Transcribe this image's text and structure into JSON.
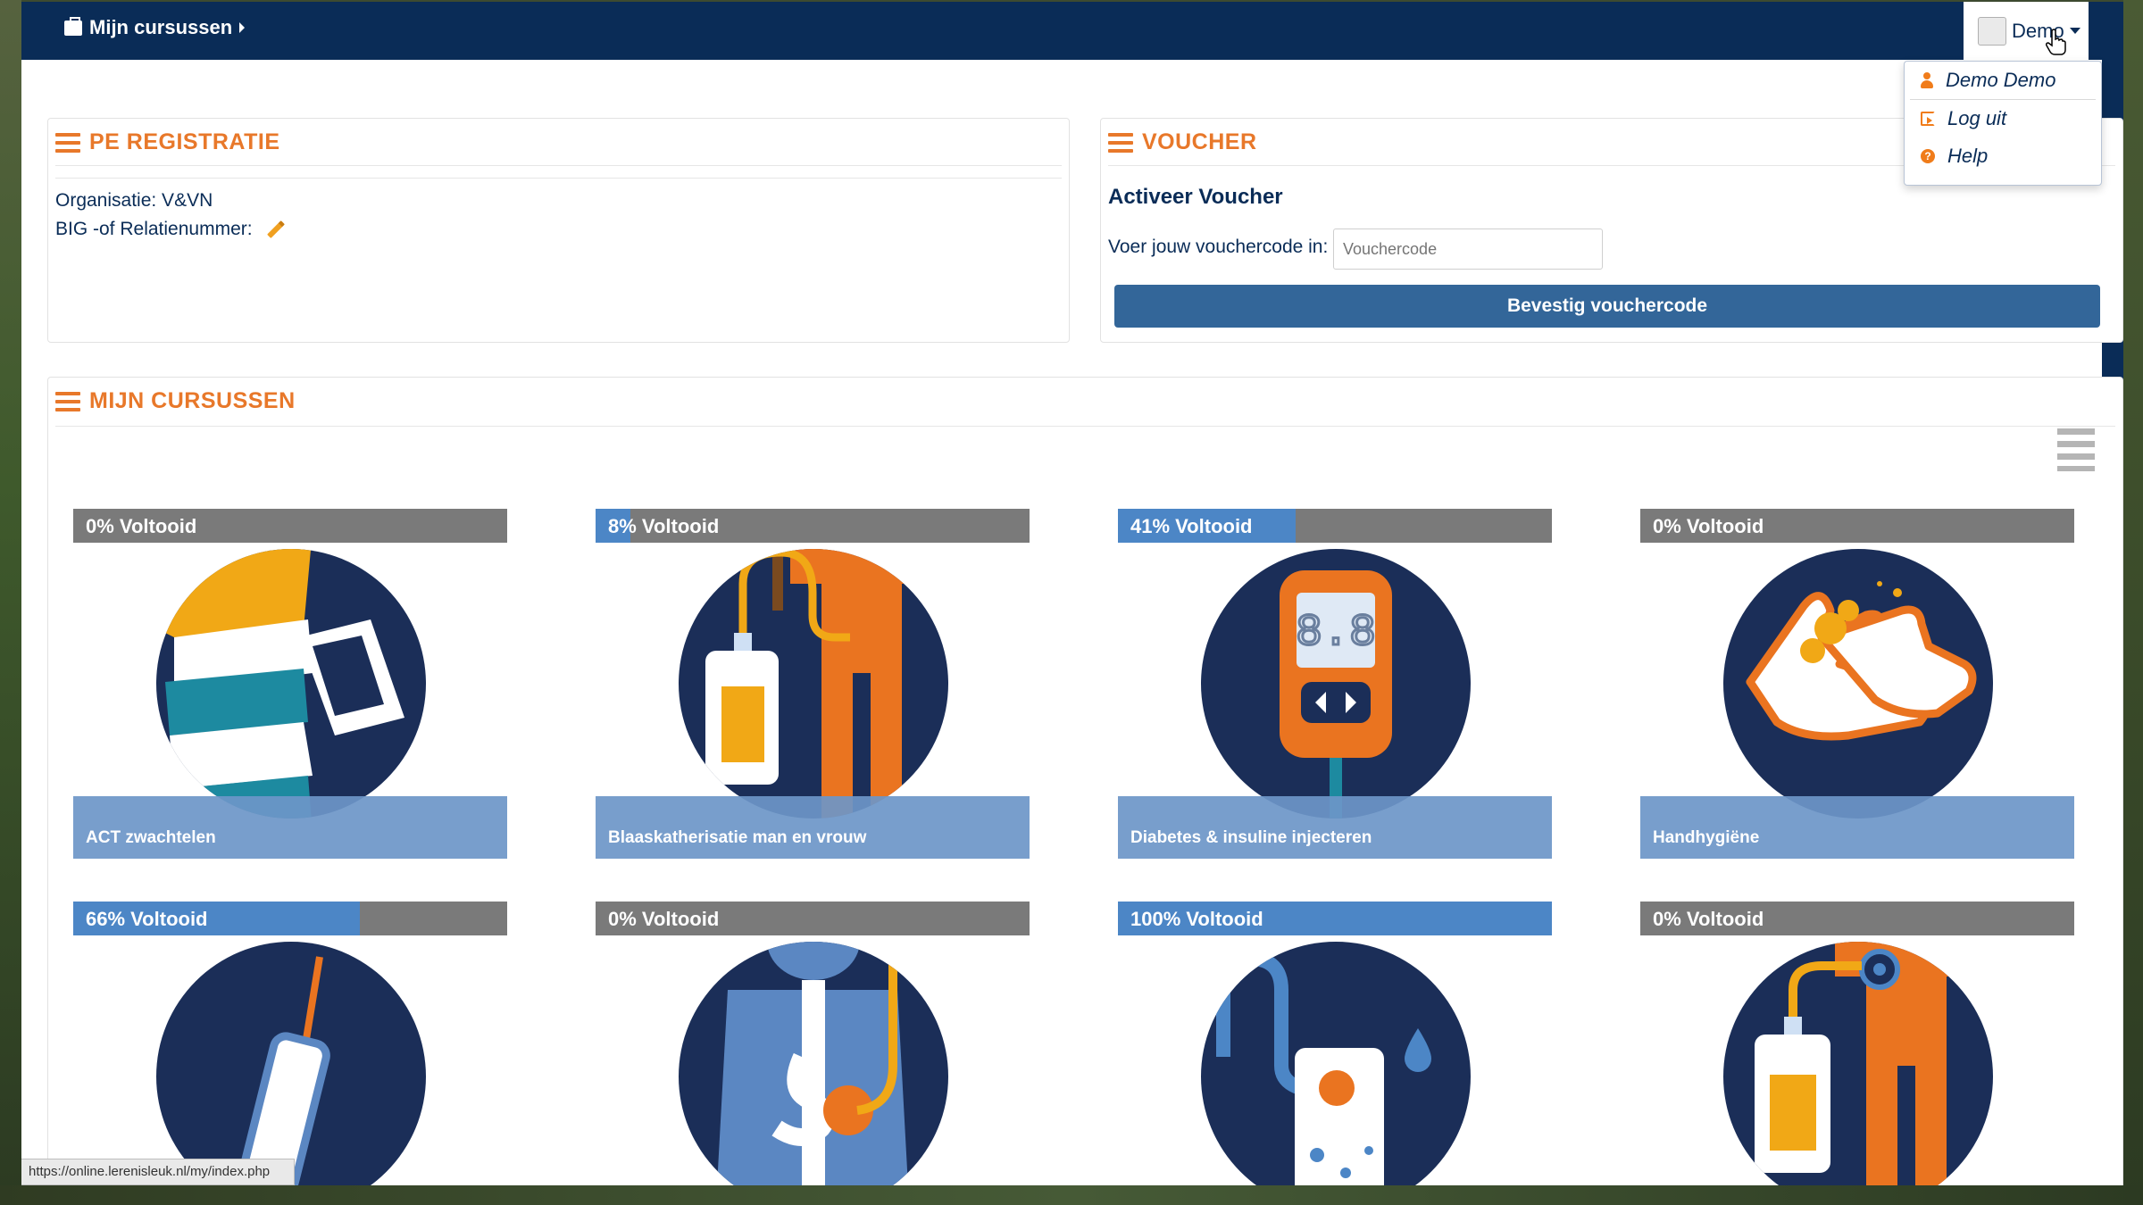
{
  "nav": {
    "brand": "Mijn cursussen",
    "user": "Demo"
  },
  "dropdown": {
    "items": [
      {
        "label": "Demo Demo",
        "icon": "user-icon"
      },
      {
        "label": "Log uit",
        "icon": "logout-icon"
      },
      {
        "label": "Help",
        "icon": "help-icon"
      }
    ]
  },
  "pe": {
    "title": "PE REGISTRATIE",
    "org": "Organisatie: V&VN",
    "big": "BIG -of Relatienummer:"
  },
  "voucher": {
    "title": "VOUCHER",
    "heading": "Activeer Voucher",
    "prompt": "Voer jouw vouchercode in:",
    "placeholder": "Vouchercode",
    "button": "Bevestig vouchercode"
  },
  "courses_panel": {
    "title": "MIJN CURSUSSEN"
  },
  "courses": [
    {
      "progress_label": "0% Voltooid",
      "progress": 0,
      "name": "ACT zwachtelen",
      "icon": "bandage-icon"
    },
    {
      "progress_label": "8% Voltooid",
      "progress": 8,
      "name": "Blaaskatherisatie man en vrouw",
      "icon": "catheter-bag-icon"
    },
    {
      "progress_label": "41% Voltooid",
      "progress": 41,
      "name": "Diabetes & insuline injecteren",
      "icon": "glucose-meter-icon"
    },
    {
      "progress_label": "0% Voltooid",
      "progress": 0,
      "name": "Handhygiëne",
      "icon": "hand-washing-icon"
    },
    {
      "progress_label": "66% Voltooid",
      "progress": 66,
      "name": "",
      "icon": "syringe-icon"
    },
    {
      "progress_label": "0% Voltooid",
      "progress": 0,
      "name": "",
      "icon": "stomach-tube-icon"
    },
    {
      "progress_label": "100% Voltooid",
      "progress": 100,
      "name": "",
      "icon": "infusion-bag-icon"
    },
    {
      "progress_label": "0% Voltooid",
      "progress": 0,
      "name": "",
      "icon": "urine-bag-icon"
    }
  ],
  "status_url": "https://online.lerenisleuk.nl/my/index.php",
  "colors": {
    "nav": "#0a2c57",
    "accent": "#e8782a",
    "button": "#336699",
    "progress": "#4c86c6"
  }
}
